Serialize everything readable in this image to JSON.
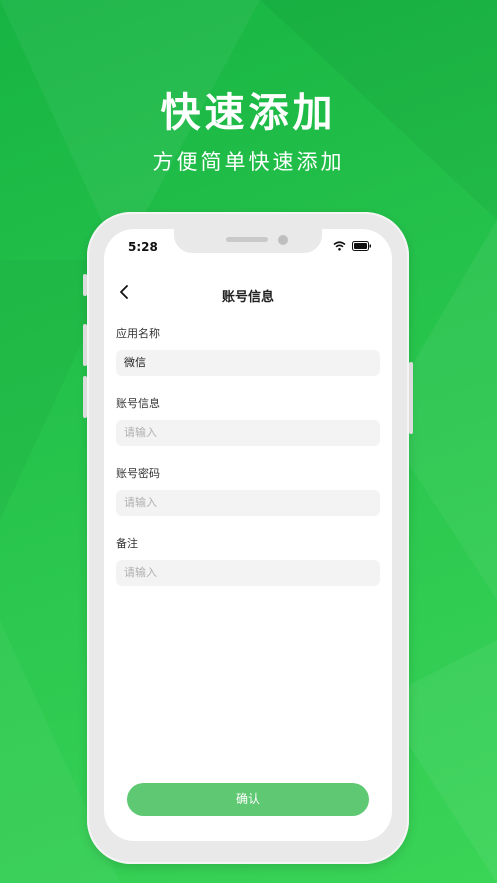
{
  "banner": {
    "headline": "快速添加",
    "subheadline": "方便简单快速添加"
  },
  "status_bar": {
    "time": "5:28"
  },
  "nav": {
    "title": "账号信息"
  },
  "form": {
    "fields": [
      {
        "label": "应用名称",
        "value": "微信",
        "placeholder": ""
      },
      {
        "label": "账号信息",
        "value": "",
        "placeholder": "请输入"
      },
      {
        "label": "账号密码",
        "value": "",
        "placeholder": "请输入"
      },
      {
        "label": "备注",
        "value": "",
        "placeholder": "请输入"
      }
    ],
    "confirm_label": "确认"
  },
  "colors": {
    "background_green": "#25c24b",
    "button_green": "#5ec872",
    "field_bg": "#f3f3f3"
  }
}
